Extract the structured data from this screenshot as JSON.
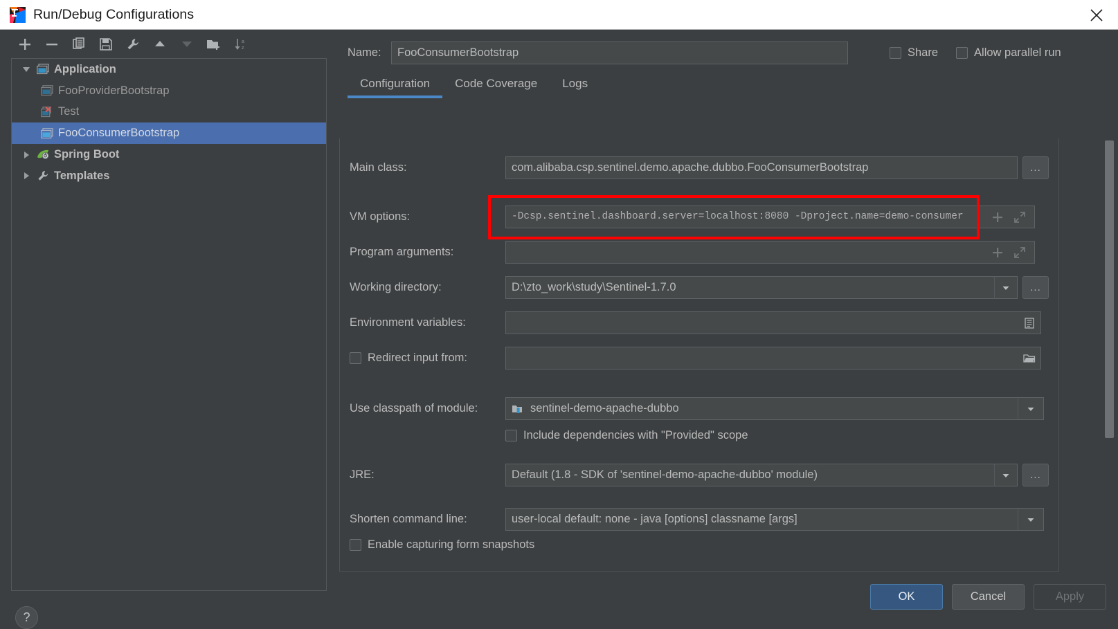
{
  "window": {
    "title": "Run/Debug Configurations",
    "logo_icon": "intellij-idea-logo",
    "close_icon": "close-icon"
  },
  "toolbar": {
    "items": [
      {
        "icon": "plus-icon",
        "label": "Add New Configuration"
      },
      {
        "icon": "minus-icon",
        "label": "Remove Configuration"
      },
      {
        "icon": "copy-icon",
        "label": "Copy Configuration"
      },
      {
        "icon": "save-icon",
        "label": "Save Configuration"
      },
      {
        "icon": "wrench-icon",
        "label": "Edit Templates"
      },
      {
        "icon": "arrow-up-icon",
        "label": "Move Up"
      },
      {
        "icon": "arrow-down-icon",
        "label": "Move Down"
      },
      {
        "icon": "new-folder-icon",
        "label": "Create New Folder"
      },
      {
        "icon": "sort-alphabetical-icon",
        "label": "Sort Configurations"
      }
    ]
  },
  "tree": {
    "nodes": [
      {
        "label": "Application",
        "level": 1,
        "expanded": true,
        "selected": false,
        "icon": "application-icon",
        "twisty": "chevron-down-icon",
        "style": "group"
      },
      {
        "label": "FooProviderBootstrap",
        "level": 2,
        "expanded": null,
        "selected": false,
        "icon": "application-icon",
        "twisty": "none",
        "style": "child"
      },
      {
        "label": "Test",
        "level": 2,
        "expanded": null,
        "selected": false,
        "icon": "application-error-icon",
        "twisty": "none",
        "style": "child"
      },
      {
        "label": "FooConsumerBootstrap",
        "level": 2,
        "expanded": null,
        "selected": true,
        "icon": "application-icon",
        "twisty": "none",
        "style": "child"
      },
      {
        "label": "Spring Boot",
        "level": 1,
        "expanded": false,
        "selected": false,
        "icon": "spring-boot-icon",
        "twisty": "chevron-right-icon",
        "style": "group"
      },
      {
        "label": "Templates",
        "level": 1,
        "expanded": false,
        "selected": false,
        "icon": "wrench-icon",
        "twisty": "chevron-right-icon",
        "style": "group"
      }
    ]
  },
  "help": {
    "icon": "help-icon",
    "label": "?"
  },
  "name_row": {
    "label": "Name:",
    "value": "FooConsumerBootstrap",
    "share": {
      "label": "Share",
      "checked": false
    },
    "allow_parallel": {
      "label": "Allow parallel run",
      "checked": false
    }
  },
  "tabs": [
    {
      "label": "Configuration",
      "active": true
    },
    {
      "label": "Code Coverage",
      "active": false
    },
    {
      "label": "Logs",
      "active": false
    }
  ],
  "form": {
    "main_class": {
      "label": "Main class:",
      "value": "com.alibaba.csp.sentinel.demo.apache.dubbo.FooConsumerBootstrap",
      "browse_label": "...",
      "browse_icon": "ellipsis-icon"
    },
    "vm_options": {
      "label": "VM options:",
      "value": "-Dcsp.sentinel.dashboard.server=localhost:8080 -Dproject.name=demo-consumer",
      "add_icon": "plus-icon",
      "expand_icon": "expand-diagonal-icon",
      "highlighted": true
    },
    "program_arguments": {
      "label": "Program arguments:",
      "value": "",
      "add_icon": "plus-icon",
      "expand_icon": "expand-diagonal-icon"
    },
    "working_directory": {
      "label": "Working directory:",
      "value": "D:\\zto_work\\study\\Sentinel-1.7.0",
      "dropdown_icon": "chevron-down-icon",
      "browse_label": "...",
      "browse_icon": "ellipsis-icon"
    },
    "environment_variables": {
      "label": "Environment variables:",
      "value": "",
      "browse_icon": "list-icon"
    },
    "redirect_input": {
      "label": "Redirect input from:",
      "checked": false,
      "value": "",
      "browse_icon": "folder-icon"
    },
    "use_classpath": {
      "label": "Use classpath of module:",
      "value": "sentinel-demo-apache-dubbo",
      "value_icon": "module-icon",
      "dropdown_icon": "chevron-down-icon"
    },
    "include_provided": {
      "label": "Include dependencies with \"Provided\" scope",
      "checked": false
    },
    "jre": {
      "label": "JRE:",
      "value": "Default (1.8 - SDK of 'sentinel-demo-apache-dubbo' module)",
      "dropdown_icon": "chevron-down-icon",
      "browse_label": "...",
      "browse_icon": "ellipsis-icon"
    },
    "shorten_command_line": {
      "label": "Shorten command line:",
      "value": "user-local default: none - java [options] classname [args]",
      "dropdown_icon": "chevron-down-icon"
    },
    "enable_capturing": {
      "label": "Enable capturing form snapshots",
      "checked": false
    }
  },
  "footer": {
    "ok": "OK",
    "cancel": "Cancel",
    "apply": "Apply",
    "apply_enabled": false
  },
  "colors": {
    "background": "#3c3f41",
    "titlebar": "#ffffff",
    "field_bg": "#45494a",
    "selection": "#4b6eaf",
    "accent": "#4a88c7",
    "ok_button": "#365880",
    "highlight": "#ff0000",
    "text": "#bbbbbb"
  }
}
